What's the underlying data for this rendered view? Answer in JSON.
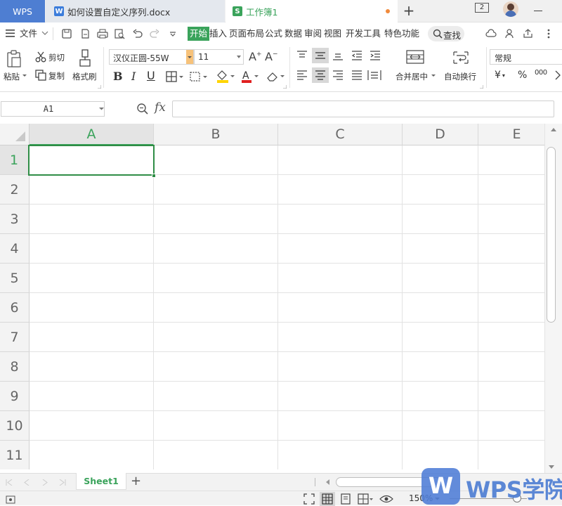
{
  "tabs": {
    "wps": "WPS",
    "doc": "如何设置自定义序列.docx",
    "doc_icon": "W",
    "book": "工作簿1",
    "book_icon": "S",
    "add": "+",
    "badge": "2"
  },
  "menu": {
    "file": "文件",
    "items": [
      "开始",
      "插入",
      "页面布局",
      "公式",
      "数据",
      "审阅",
      "视图",
      "开发工具",
      "特色功能"
    ],
    "search": "查找"
  },
  "ribbon": {
    "paste": "粘贴",
    "cut": "剪切",
    "copy": "复制",
    "format_painter": "格式刷",
    "font_name": "汉仪正圆-55W",
    "font_size": "11",
    "merge_center": "合并居中",
    "wrap_text": "自动换行",
    "number_format": "常规",
    "currency": "¥",
    "percent": "%",
    "thousands": "000"
  },
  "formula": {
    "name_box": "A1",
    "fx": "fx",
    "value": ""
  },
  "grid": {
    "columns": [
      "A",
      "B",
      "C",
      "D",
      "E"
    ],
    "rows": [
      "1",
      "2",
      "3",
      "4",
      "5",
      "6",
      "7",
      "8",
      "9",
      "10",
      "11"
    ],
    "selected_cell": "A1"
  },
  "sheets": {
    "tabs": [
      "Sheet1"
    ],
    "add": "+"
  },
  "status": {
    "zoom": "150%"
  },
  "watermark": {
    "text": "WPS学院",
    "logo_letter": "W"
  },
  "colors": {
    "accent_green": "#3aa35b",
    "wps_blue": "#4e7ed2",
    "selection_green": "#2f8d46"
  }
}
